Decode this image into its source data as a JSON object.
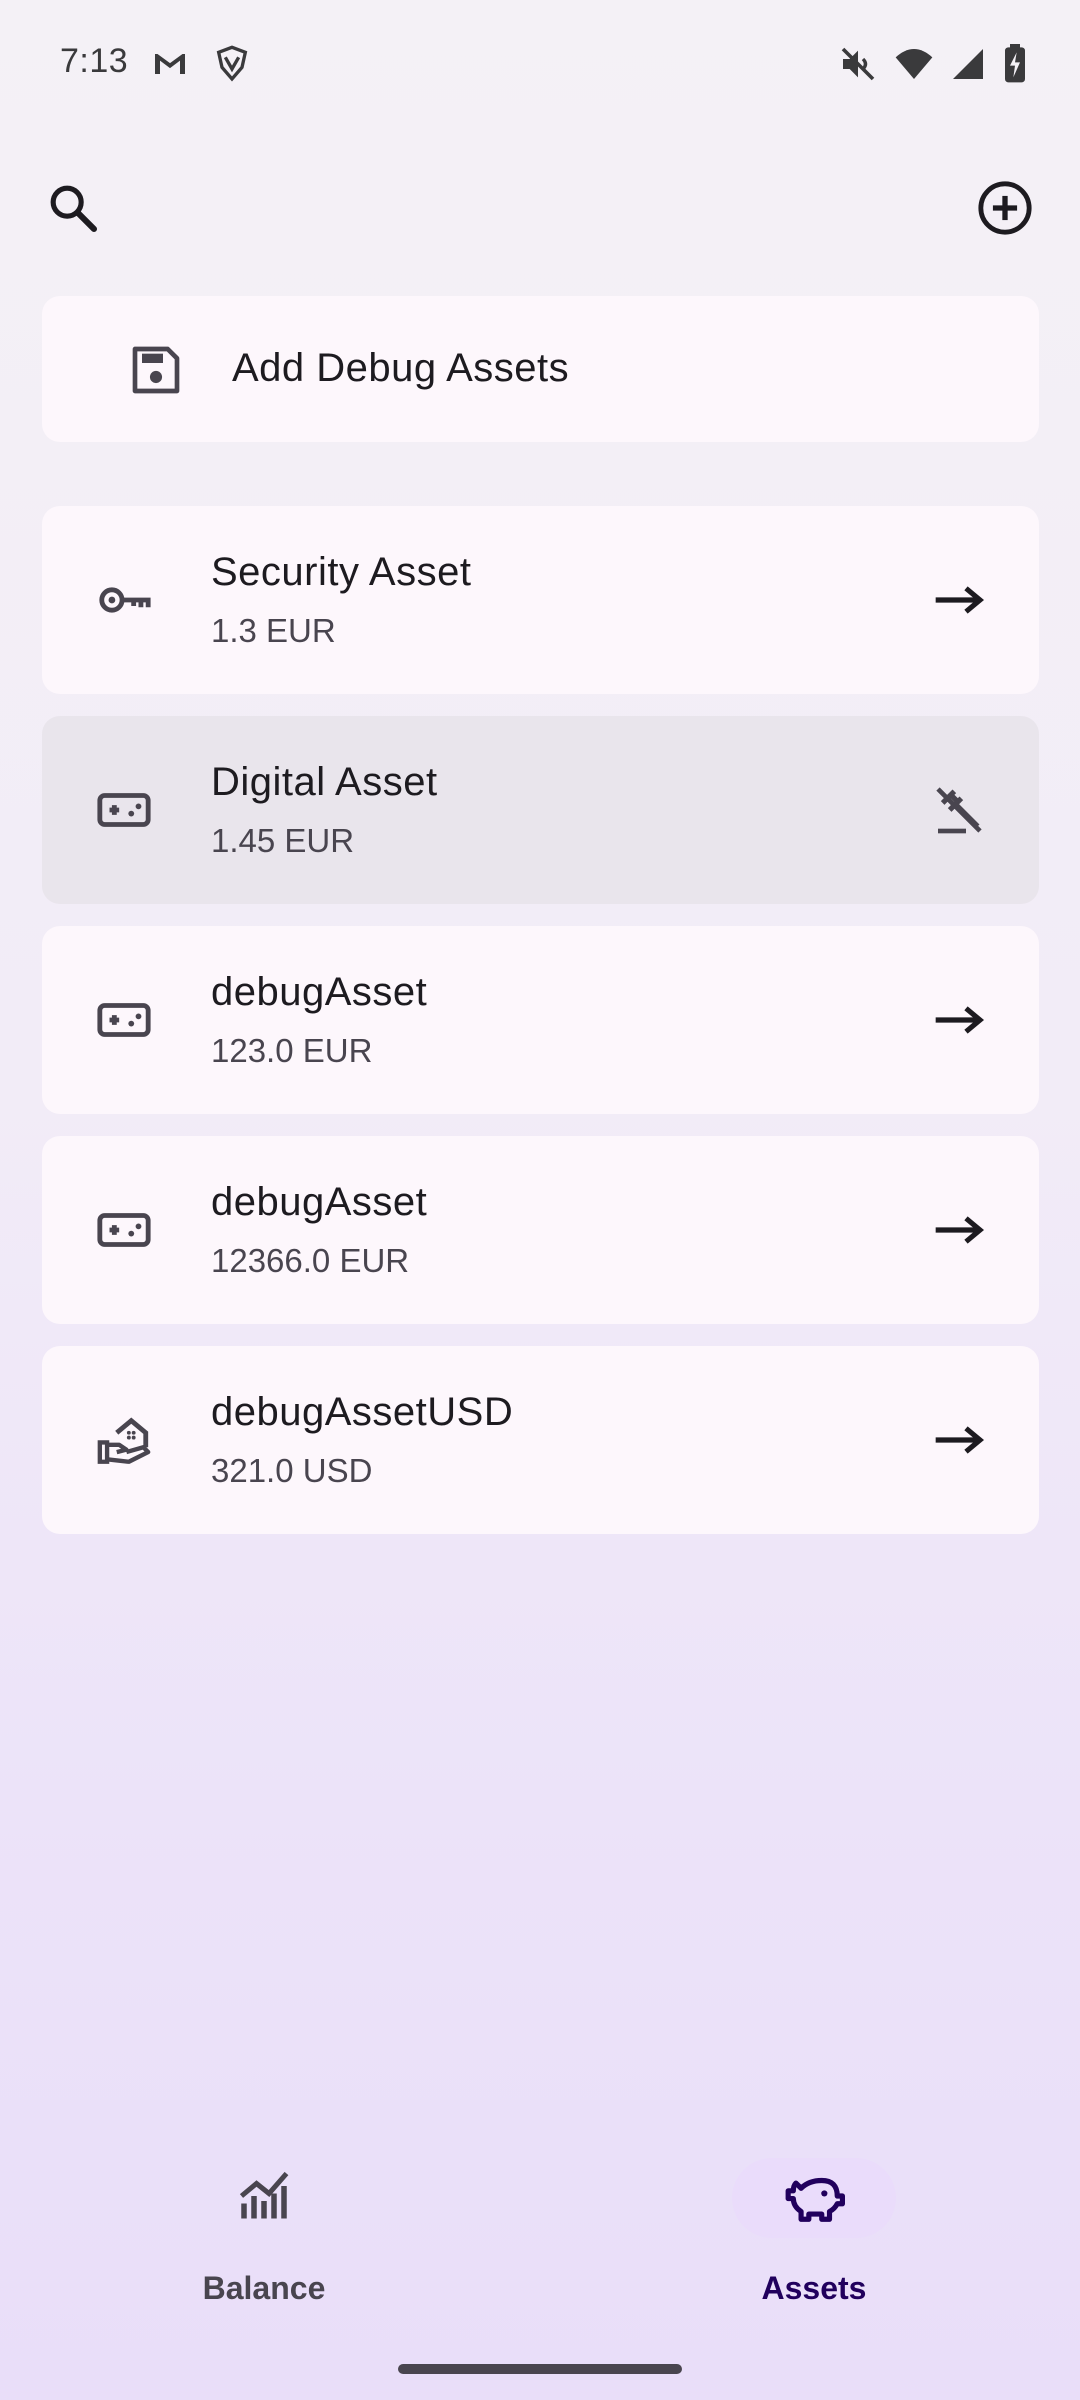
{
  "status_bar": {
    "time": "7:13",
    "left_icons": [
      "gmail-icon",
      "vpn-shield-icon"
    ],
    "right_icons": [
      "mute-icon",
      "wifi-icon",
      "signal-icon",
      "battery-charging-icon"
    ]
  },
  "top_bar": {
    "search_icon": "search-icon",
    "add_icon": "add-circle-icon"
  },
  "debug_card": {
    "icon": "save-icon",
    "label": "Add Debug Assets"
  },
  "assets": [
    {
      "name": "Security Asset",
      "value": "1.3 EUR",
      "icon": "key-icon",
      "action": "arrow-right-icon",
      "selected": false
    },
    {
      "name": "Digital Asset",
      "value": "1.45 EUR",
      "icon": "gamepad-icon",
      "action": "gavel-off-icon",
      "selected": true
    },
    {
      "name": "debugAsset",
      "value": "123.0 EUR",
      "icon": "gamepad-icon",
      "action": "arrow-right-icon",
      "selected": false
    },
    {
      "name": "debugAsset",
      "value": "12366.0 EUR",
      "icon": "gamepad-icon",
      "action": "arrow-right-icon",
      "selected": false
    },
    {
      "name": "debugAssetUSD",
      "value": "321.0 USD",
      "icon": "real-estate-icon",
      "action": "arrow-right-icon",
      "selected": false
    }
  ],
  "bottom_nav": {
    "items": [
      {
        "label": "Balance",
        "icon": "chart-icon",
        "active": false
      },
      {
        "label": "Assets",
        "icon": "piggy-bank-icon",
        "active": true
      }
    ]
  },
  "colors": {
    "card": "#fdf7fc",
    "card_selected": "#e9e5ec",
    "nav_active_pill": "#eadcfb",
    "nav_active_text": "#21005d"
  }
}
